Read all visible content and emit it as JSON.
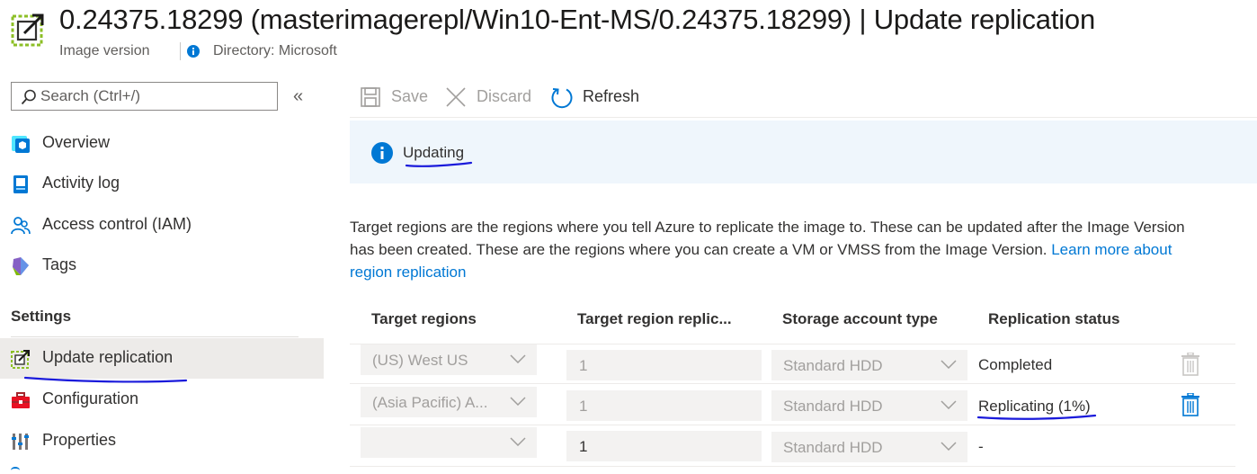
{
  "header": {
    "title": "0.24375.18299 (masterimagerepl/Win10-Ent-MS/0.24375.18299) | Update replication",
    "resource_type": "Image version",
    "directory": "Directory: Microsoft"
  },
  "sidebar": {
    "search_placeholder": "Search (Ctrl+/)",
    "collapse_glyph": "«",
    "items": [
      {
        "label": "Overview",
        "icon": "image-version-icon"
      },
      {
        "label": "Activity log",
        "icon": "activity-log-icon"
      },
      {
        "label": "Access control (IAM)",
        "icon": "people-icon"
      },
      {
        "label": "Tags",
        "icon": "tag-icon"
      }
    ],
    "section_settings": "Settings",
    "settings_items": [
      {
        "label": "Update replication",
        "icon": "update-replication-icon",
        "selected": true
      },
      {
        "label": "Configuration",
        "icon": "toolbox-icon"
      },
      {
        "label": "Properties",
        "icon": "properties-icon"
      }
    ]
  },
  "toolbar": {
    "save": "Save",
    "discard": "Discard",
    "refresh": "Refresh"
  },
  "banner": {
    "text": "Updating"
  },
  "description": {
    "text": "Target regions are the regions where you tell Azure to replicate the image to. These can be updated after the Image Version has been created. These are the regions where you can create a VM or VMSS from the Image Version. ",
    "link": "Learn more about region replication"
  },
  "table": {
    "headers": [
      "Target regions",
      "Target region replic...",
      "Storage account type",
      "Replication status"
    ],
    "rows": [
      {
        "region": "(US) West US",
        "replicas": "1",
        "storage": "Standard HDD",
        "status": "Completed",
        "delete_enabled": false
      },
      {
        "region": "(Asia Pacific) A...",
        "replicas": "1",
        "storage": "Standard HDD",
        "status": "Replicating (1%)",
        "delete_enabled": true
      },
      {
        "region": "",
        "replicas": "1",
        "storage": "Standard HDD",
        "status": "-",
        "delete_enabled": false
      }
    ]
  },
  "colors": {
    "accent": "#0078d4",
    "banner_bg": "#eff6fc",
    "selected_bg": "#edebe9",
    "disabled_text": "#a19f9d",
    "annotation_ink": "#1a1adb"
  }
}
